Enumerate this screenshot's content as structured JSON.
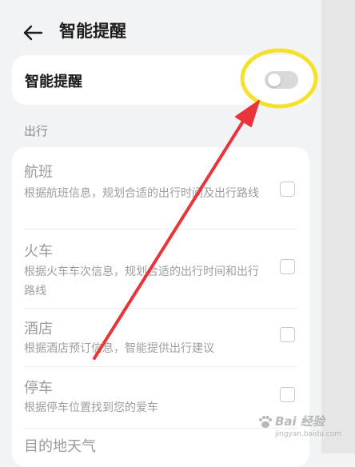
{
  "header": {
    "title": "智能提醒"
  },
  "toggle_card": {
    "label": "智能提醒",
    "switch_on": false
  },
  "section": {
    "label": "出行"
  },
  "items": [
    {
      "title": "航班",
      "desc": "根据航班信息，规划合适的出行时间及出行路线",
      "checked": false
    },
    {
      "title": "火车",
      "desc": "根据火车车次信息，规划合适的出行时间和出行路线",
      "checked": false
    },
    {
      "title": "酒店",
      "desc": "根据酒店预订信息，智能提供出行建议",
      "checked": false
    },
    {
      "title": "停车",
      "desc": "根据停车位置找到您的爱车",
      "checked": false
    },
    {
      "title": "目的地天气",
      "desc": "",
      "checked": false
    }
  ],
  "watermark": {
    "main": "Bai 经验",
    "sub": "jingyan.baidu.com"
  },
  "colors": {
    "highlight_circle": "#f5e12b",
    "arrow": "#e8343a",
    "background": "#f1f3f5",
    "card": "#ffffff"
  }
}
